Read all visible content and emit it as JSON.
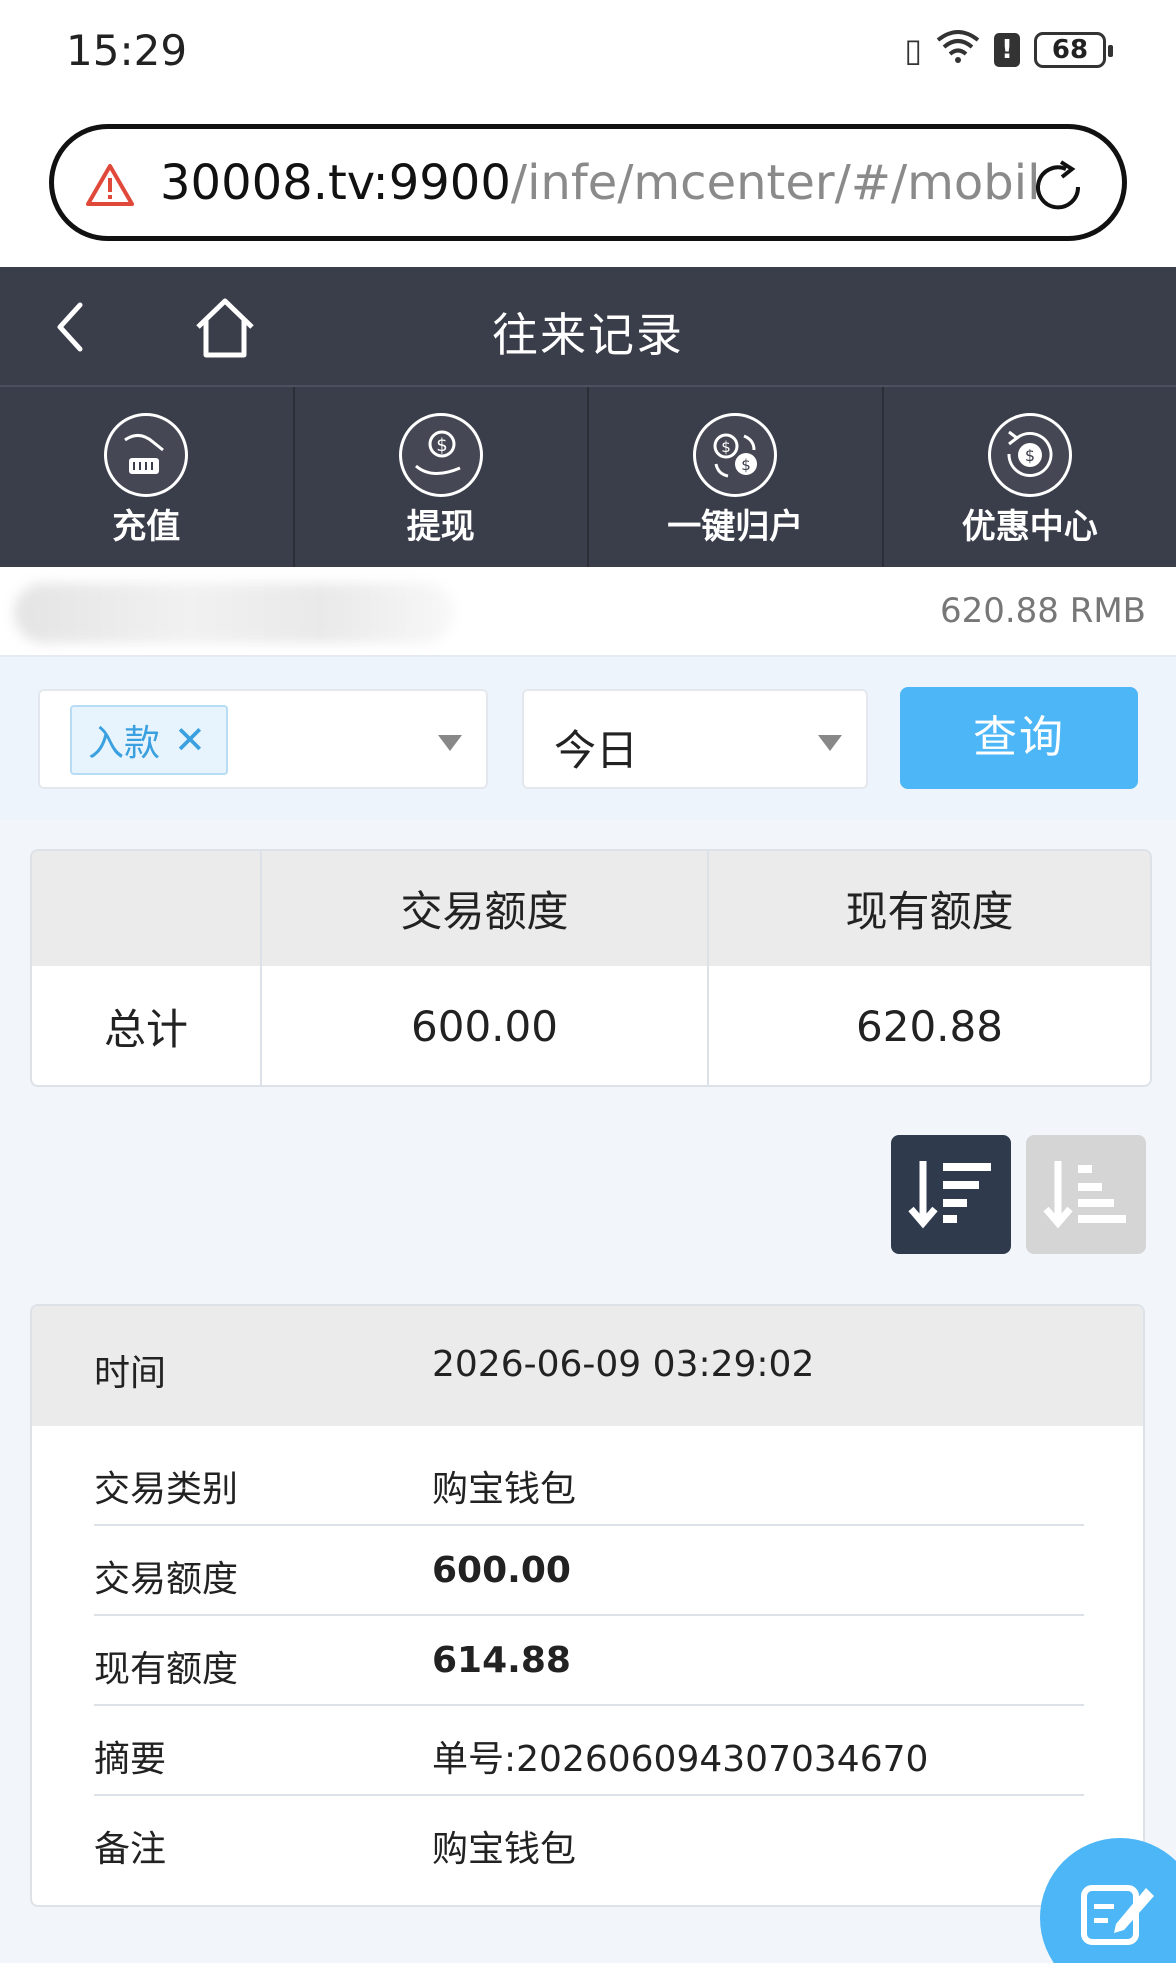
{
  "status_bar": {
    "time": "15:29",
    "battery": "68"
  },
  "browser": {
    "url_host": "30008.tv:9900",
    "url_path": "/infe/mcenter/#/mobile/"
  },
  "header": {
    "title": "往来记录"
  },
  "quick_nav": [
    {
      "label": "充值",
      "icon": "deposit-icon"
    },
    {
      "label": "提现",
      "icon": "withdraw-icon"
    },
    {
      "label": "一键归户",
      "icon": "transfer-all-icon"
    },
    {
      "label": "优惠中心",
      "icon": "promotion-icon"
    }
  ],
  "account": {
    "balance": "620.88 RMB"
  },
  "filter": {
    "type_tag": "入款",
    "date_value": "今日",
    "query_label": "查询"
  },
  "summary": {
    "headers": [
      "",
      "交易额度",
      "现有额度"
    ],
    "row_label": "总计",
    "trade_amount": "600.00",
    "current_amount": "620.88"
  },
  "record": {
    "time_label": "时间",
    "time_value": "2026-06-09 03:29:02",
    "rows": [
      {
        "label": "交易类别",
        "value": "购宝钱包"
      },
      {
        "label": "交易额度",
        "value": "600.00"
      },
      {
        "label": "现有额度",
        "value": "614.88"
      },
      {
        "label": "摘要",
        "value": "单号:202606094307034670"
      },
      {
        "label": "备注",
        "value": "购宝钱包"
      }
    ]
  },
  "colors": {
    "header_bg": "#3a3d4a",
    "accent_blue": "#4db6f7",
    "tag_blue": "#3aa0e0",
    "sort_active": "#2f3a4d"
  }
}
